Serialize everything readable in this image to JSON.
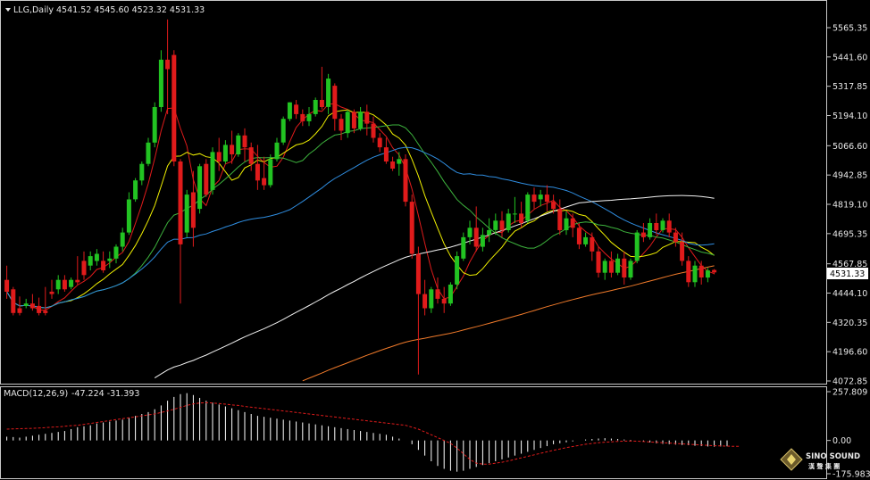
{
  "header": {
    "symbol": "LLG,Daily",
    "ohlc": "4541.52 4545.60 4523.32 4531.33",
    "macd_label": "MACD(12,26,9)",
    "macd_values": "-47.224 -31.393"
  },
  "price_axis": {
    "ticks": [
      "5565.35",
      "5441.60",
      "5317.85",
      "5194.10",
      "5066.60",
      "4942.85",
      "4819.10",
      "4695.35",
      "4567.85",
      "4444.10",
      "4320.35",
      "4196.60",
      "4072.85"
    ],
    "current": "4531.33"
  },
  "macd_axis": {
    "ticks": [
      "257.809",
      "0.00",
      "-175.983"
    ]
  },
  "logo": {
    "name": "SINO SOUND",
    "subtitle": "漢 聲 集 團"
  },
  "colors": {
    "background": "#000000",
    "bull": "#22c322",
    "bear": "#e01b1b",
    "axis": "#c8c8c8",
    "ma_red": "#e01b1b",
    "ma_yellow": "#f0f000",
    "ma_green": "#3db33d",
    "ma_blue": "#2f8de0",
    "ma_white": "#f2f2f2",
    "ma_orange": "#f07a2a",
    "macd_hist": "#ffffff",
    "macd_signal": "#e01b1b"
  },
  "chart_data": {
    "type": "candlestick",
    "price_range": [
      4072.85,
      5565.35
    ],
    "macd_range": [
      -175.983,
      257.809
    ],
    "candles": [
      [
        4500,
        4560,
        4450,
        4420
      ],
      [
        4460,
        4470,
        4360,
        4350
      ],
      [
        4380,
        4430,
        4360,
        4350
      ],
      [
        4390,
        4420,
        4400,
        4380
      ],
      [
        4400,
        4440,
        4380,
        4370
      ],
      [
        4390,
        4425,
        4360,
        4350
      ],
      [
        4370,
        4470,
        4360,
        4350
      ],
      [
        4450,
        4500,
        4440,
        4420
      ],
      [
        4460,
        4520,
        4500,
        4440
      ],
      [
        4500,
        4520,
        4460,
        4450
      ],
      [
        4470,
        4510,
        4500,
        4460
      ],
      [
        4500,
        4600,
        4490,
        4480
      ],
      [
        4580,
        4620,
        4520,
        4500
      ],
      [
        4560,
        4620,
        4600,
        4540
      ],
      [
        4580,
        4630,
        4610,
        4560
      ],
      [
        4580,
        4620,
        4540,
        4530
      ],
      [
        4580,
        4620,
        4590,
        4550
      ],
      [
        4590,
        4650,
        4640,
        4570
      ],
      [
        4640,
        4720,
        4700,
        4620
      ],
      [
        4700,
        4870,
        4840,
        4690
      ],
      [
        4840,
        4930,
        4920,
        4830
      ],
      [
        4920,
        5000,
        4990,
        4900
      ],
      [
        4990,
        5100,
        5080,
        4980
      ],
      [
        5080,
        5250,
        5230,
        5060
      ],
      [
        5230,
        5470,
        5430,
        5210
      ],
      [
        5430,
        5600,
        5390,
        5200
      ],
      [
        5450,
        5470,
        5000,
        4980
      ],
      [
        5000,
        5010,
        4650,
        4400
      ],
      [
        4700,
        4880,
        4860,
        4680
      ],
      [
        4870,
        4960,
        4720,
        4640
      ],
      [
        4800,
        4990,
        4980,
        4780
      ],
      [
        4990,
        5010,
        4860,
        4850
      ],
      [
        4880,
        5060,
        5040,
        4860
      ],
      [
        5040,
        5100,
        5000,
        4960
      ],
      [
        5000,
        5090,
        5070,
        4990
      ],
      [
        5070,
        5130,
        5030,
        4990
      ],
      [
        5030,
        5120,
        5110,
        5020
      ],
      [
        5110,
        5140,
        5060,
        5000
      ],
      [
        5060,
        5080,
        4990,
        4960
      ],
      [
        4990,
        5070,
        4920,
        4880
      ],
      [
        4930,
        5020,
        4900,
        4880
      ],
      [
        4900,
        5030,
        5010,
        4890
      ],
      [
        5010,
        5100,
        5080,
        5000
      ],
      [
        5080,
        5190,
        5180,
        5070
      ],
      [
        5180,
        5250,
        5250,
        5170
      ],
      [
        5240,
        5260,
        5200,
        5180
      ],
      [
        5200,
        5220,
        5170,
        5150
      ],
      [
        5170,
        5230,
        5200,
        5150
      ],
      [
        5200,
        5270,
        5260,
        5190
      ],
      [
        5260,
        5400,
        5230,
        5220
      ],
      [
        5230,
        5370,
        5350,
        5200
      ],
      [
        5320,
        5330,
        5180,
        5130
      ],
      [
        5180,
        5200,
        5130,
        5090
      ],
      [
        5120,
        5220,
        5210,
        5100
      ],
      [
        5210,
        5220,
        5140,
        5120
      ],
      [
        5140,
        5230,
        5210,
        5130
      ],
      [
        5210,
        5240,
        5160,
        5110
      ],
      [
        5160,
        5190,
        5100,
        5080
      ],
      [
        5100,
        5120,
        5060,
        5040
      ],
      [
        5060,
        5100,
        5000,
        4990
      ],
      [
        5000,
        5020,
        4970,
        4960
      ],
      [
        4990,
        5040,
        5010,
        4940
      ],
      [
        5010,
        5030,
        4830,
        4810
      ],
      [
        4830,
        4860,
        4610,
        4590
      ],
      [
        4610,
        4640,
        4440,
        4100
      ],
      [
        4440,
        4500,
        4380,
        4350
      ],
      [
        4380,
        4470,
        4460,
        4360
      ],
      [
        4460,
        4510,
        4420,
        4400
      ],
      [
        4420,
        4470,
        4400,
        4360
      ],
      [
        4400,
        4490,
        4480,
        4390
      ],
      [
        4480,
        4620,
        4600,
        4460
      ],
      [
        4590,
        4700,
        4680,
        4580
      ],
      [
        4680,
        4750,
        4720,
        4650
      ],
      [
        4720,
        4810,
        4640,
        4620
      ],
      [
        4640,
        4720,
        4690,
        4620
      ],
      [
        4690,
        4760,
        4710,
        4660
      ],
      [
        4710,
        4780,
        4750,
        4690
      ],
      [
        4750,
        4790,
        4710,
        4680
      ],
      [
        4710,
        4800,
        4780,
        4700
      ],
      [
        4780,
        4850,
        4780,
        4740
      ],
      [
        4780,
        4830,
        4740,
        4720
      ],
      [
        4750,
        4870,
        4860,
        4740
      ],
      [
        4860,
        4890,
        4830,
        4800
      ],
      [
        4840,
        4880,
        4860,
        4810
      ],
      [
        4860,
        4900,
        4830,
        4790
      ],
      [
        4830,
        4860,
        4800,
        4780
      ],
      [
        4800,
        4840,
        4710,
        4690
      ],
      [
        4710,
        4790,
        4760,
        4690
      ],
      [
        4760,
        4780,
        4720,
        4680
      ],
      [
        4720,
        4740,
        4650,
        4630
      ],
      [
        4650,
        4700,
        4680,
        4640
      ],
      [
        4680,
        4700,
        4620,
        4580
      ],
      [
        4620,
        4640,
        4530,
        4510
      ],
      [
        4530,
        4590,
        4580,
        4500
      ],
      [
        4580,
        4620,
        4530,
        4510
      ],
      [
        4530,
        4610,
        4590,
        4520
      ],
      [
        4590,
        4620,
        4510,
        4480
      ],
      [
        4510,
        4590,
        4580,
        4500
      ],
      [
        4580,
        4710,
        4700,
        4570
      ],
      [
        4700,
        4740,
        4680,
        4660
      ],
      [
        4680,
        4760,
        4740,
        4670
      ],
      [
        4740,
        4780,
        4710,
        4690
      ],
      [
        4710,
        4760,
        4750,
        4700
      ],
      [
        4750,
        4780,
        4700,
        4680
      ],
      [
        4700,
        4720,
        4660,
        4640
      ],
      [
        4660,
        4700,
        4580,
        4560
      ],
      [
        4580,
        4600,
        4490,
        4470
      ],
      [
        4490,
        4580,
        4560,
        4470
      ],
      [
        4560,
        4580,
        4510,
        4480
      ],
      [
        4510,
        4550,
        4540,
        4490
      ],
      [
        4541.52,
        4545.6,
        4531.33,
        4523.32
      ]
    ],
    "macd_hist": [
      20,
      18,
      15,
      20,
      25,
      30,
      35,
      40,
      45,
      50,
      60,
      70,
      75,
      80,
      90,
      95,
      100,
      105,
      110,
      120,
      130,
      140,
      150,
      165,
      185,
      210,
      230,
      245,
      250,
      240,
      225,
      210,
      200,
      190,
      180,
      170,
      160,
      150,
      140,
      130,
      125,
      120,
      115,
      110,
      105,
      100,
      95,
      90,
      85,
      80,
      75,
      70,
      65,
      60,
      55,
      50,
      45,
      40,
      35,
      30,
      20,
      10,
      0,
      -20,
      -50,
      -80,
      -110,
      -135,
      -150,
      -160,
      -165,
      -160,
      -150,
      -140,
      -130,
      -120,
      -110,
      -100,
      -90,
      -80,
      -70,
      -60,
      -50,
      -40,
      -30,
      -20,
      -15,
      -10,
      -5,
      0,
      5,
      8,
      10,
      12,
      10,
      8,
      5,
      3,
      0,
      -5,
      -10,
      -15,
      -18,
      -20,
      -22,
      -24,
      -25,
      -28,
      -30,
      -32,
      -33,
      -32,
      -31
    ],
    "macd_signal": [
      60,
      61,
      62,
      63,
      64,
      66,
      68,
      70,
      72,
      75,
      78,
      80,
      85,
      90,
      95,
      100,
      105,
      110,
      115,
      120,
      125,
      130,
      135,
      140,
      148,
      156,
      165,
      175,
      185,
      193,
      198,
      200,
      198,
      195,
      192,
      188,
      185,
      180,
      176,
      172,
      168,
      164,
      160,
      156,
      152,
      148,
      144,
      140,
      136,
      132,
      128,
      124,
      120,
      116,
      112,
      108,
      104,
      100,
      96,
      92,
      88,
      84,
      80,
      70,
      60,
      45,
      30,
      15,
      0,
      -15,
      -40,
      -70,
      -100,
      -120,
      -125,
      -125,
      -120,
      -115,
      -108,
      -100,
      -92,
      -84,
      -76,
      -68,
      -60,
      -52,
      -45,
      -38,
      -32,
      -26,
      -20,
      -16,
      -12,
      -9,
      -7,
      -5,
      -4,
      -3,
      -4,
      -6,
      -8,
      -10,
      -12,
      -14,
      -16,
      -18,
      -20,
      -22,
      -24,
      -26,
      -28,
      -29,
      -30,
      -31,
      -31.39
    ]
  }
}
